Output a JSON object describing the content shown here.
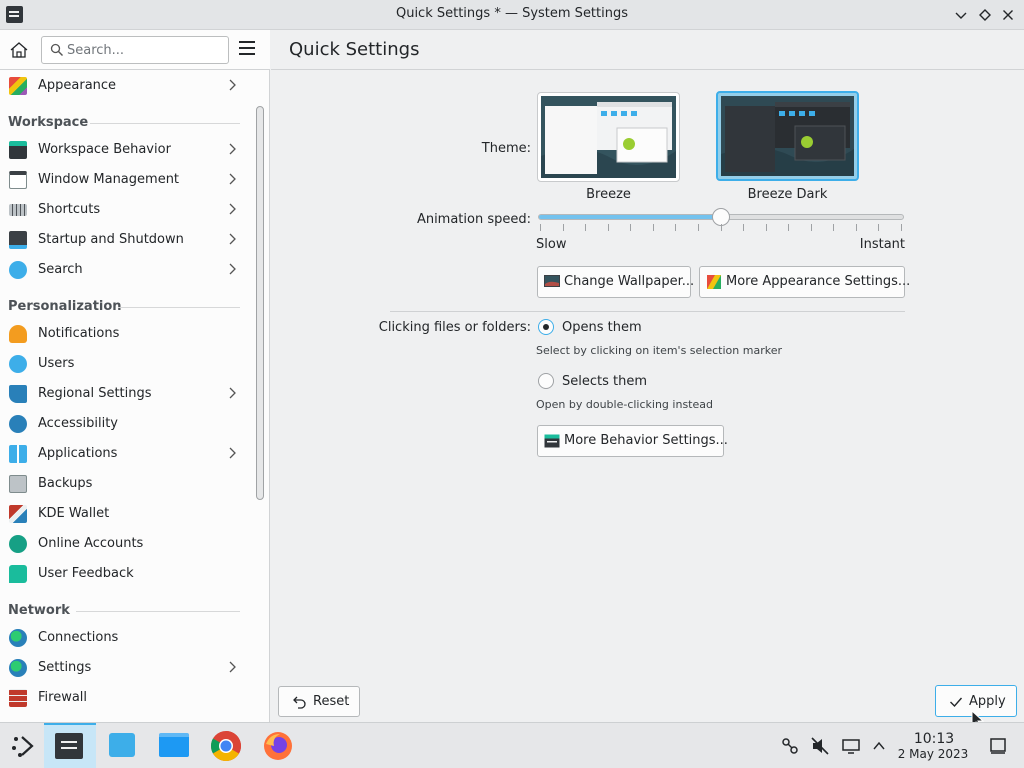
{
  "window": {
    "title": "Quick Settings * — System Settings"
  },
  "search": {
    "placeholder": "Search..."
  },
  "sidebar": {
    "top_item": "Appearance",
    "categories": [
      "Workspace",
      "Personalization",
      "Network"
    ],
    "workspace": [
      "Workspace Behavior",
      "Window Management",
      "Shortcuts",
      "Startup and Shutdown",
      "Search"
    ],
    "personalization": [
      "Notifications",
      "Users",
      "Regional Settings",
      "Accessibility",
      "Applications",
      "Backups",
      "KDE Wallet",
      "Online Accounts",
      "User Feedback"
    ],
    "network": [
      "Connections",
      "Settings",
      "Firewall"
    ]
  },
  "main": {
    "page_title": "Quick Settings",
    "theme_label": "Theme:",
    "themes": [
      "Breeze",
      "Breeze Dark"
    ],
    "selected_theme": "Breeze Dark",
    "animation_label": "Animation speed:",
    "animation_min": "Slow",
    "animation_max": "Instant",
    "animation_value": 0.5,
    "change_wallpaper": "Change Wallpaper...",
    "more_appearance": "More Appearance Settings...",
    "clicking_label": "Clicking files or folders:",
    "opt_open": "Opens them",
    "opt_open_hint": "Select by clicking on item's selection marker",
    "opt_select": "Selects them",
    "opt_select_hint": "Open by double-clicking instead",
    "more_behavior": "More Behavior Settings...",
    "reset": "Reset",
    "apply": "Apply"
  },
  "taskbar": {
    "time": "10:13",
    "date": "2 May 2023"
  },
  "colors": {
    "accent": "#3daee9",
    "window_bg": "#eff0f1",
    "view_bg": "#fcfcfc",
    "text": "#232629"
  }
}
